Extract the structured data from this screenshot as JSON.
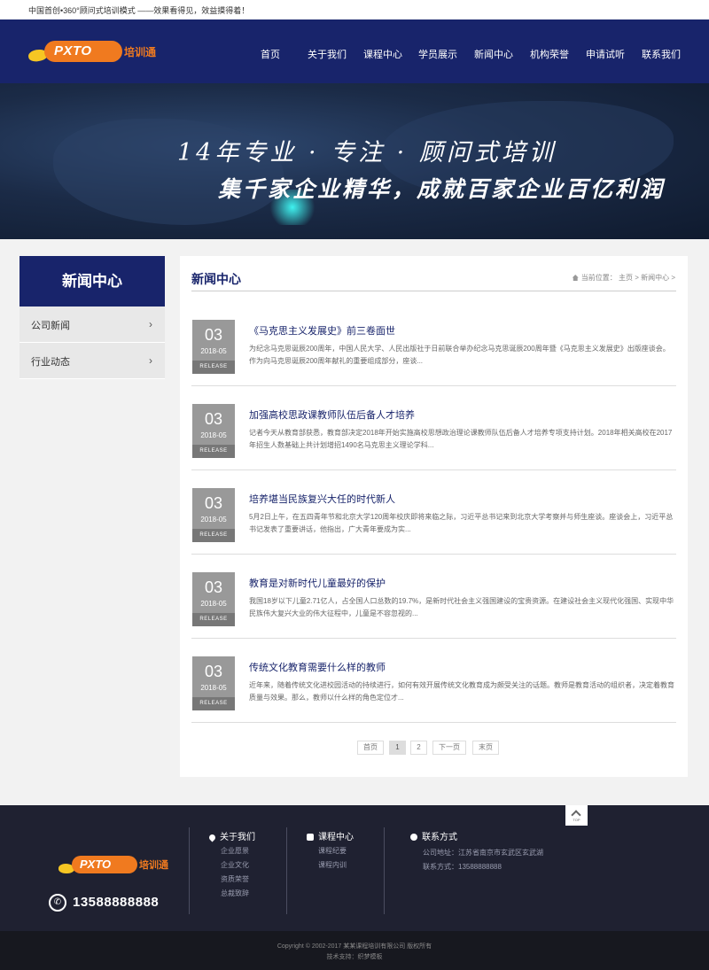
{
  "topbar": {
    "slogan": "中国首创•360°顾问式培训模式 ——效果看得见，效益摸得着！"
  },
  "logo": {
    "brand": "PXTO",
    "cn": "培训通"
  },
  "nav": [
    "首页",
    "关于我们",
    "课程中心",
    "学员展示",
    "新闻中心",
    "机构荣誉",
    "申请试听",
    "联系我们"
  ],
  "banner": {
    "line1": "14年专业 · 专注 · 顾问式培训",
    "line2": "集千家企业精华，成就百家企业百亿利润"
  },
  "sidebar": {
    "title": "新闻中心",
    "items": [
      "公司新闻",
      "行业动态"
    ],
    "chevron": "›"
  },
  "main": {
    "title": "新闻中心",
    "crumb_prefix": "当前位置：",
    "crumb_home": "主页",
    "crumb_sep": ">",
    "crumb_current": "新闻中心",
    "crumb_end": ">"
  },
  "news": [
    {
      "day": "03",
      "ym": "2018-05",
      "tag": "RELEASE",
      "title": "《马克思主义发展史》前三卷面世",
      "desc": "为纪念马克思诞辰200周年，中国人民大学、人民出版社于日前联合举办纪念马克思诞辰200周年暨《马克思主义发展史》出版座谈会。 作为向马克思诞辰200周年献礼的重要组成部分，座谈..."
    },
    {
      "day": "03",
      "ym": "2018-05",
      "tag": "RELEASE",
      "title": "加强高校思政课教师队伍后备人才培养",
      "desc": "记者今天从教育部获悉，教育部决定2018年开始实施高校思想政治理论课教师队伍后备人才培养专项支持计划。2018年相关高校在2017年招生人数基础上共计划增招1490名马克思主义理论学科..."
    },
    {
      "day": "03",
      "ym": "2018-05",
      "tag": "RELEASE",
      "title": "培养堪当民族复兴大任的时代新人",
      "desc": "5月2日上午，在五四青年节和北京大学120周年校庆即将来临之际，习近平总书记来到北京大学考察并与师生座谈。座谈会上，习近平总书记发表了重要讲话，他指出，广大青年要成为实..."
    },
    {
      "day": "03",
      "ym": "2018-05",
      "tag": "RELEASE",
      "title": "教育是对新时代儿童最好的保护",
      "desc": "我国18岁以下儿童2.71亿人，占全国人口总数的19.7%，是新时代社会主义强国建设的宝贵资源。在建设社会主义现代化强国、实现中华民族伟大复兴大业的伟大征程中，儿童是不容忽视的..."
    },
    {
      "day": "03",
      "ym": "2018-05",
      "tag": "RELEASE",
      "title": "传统文化教育需要什么样的教师",
      "desc": "近年来，随着传统文化进校园活动的持续进行，如何有效开展传统文化教育成为颇受关注的话题。教师是教育活动的组织者，决定着教育质量与效果。那么，教师以什么样的角色定位才..."
    }
  ],
  "pager": {
    "first": "首页",
    "p1": "1",
    "p2": "2",
    "next": "下一页",
    "last": "末页"
  },
  "totop": {
    "label": "TOP"
  },
  "footer": {
    "phone": "13588888888",
    "col1_title": "关于我们",
    "col1_links": [
      "企业愿景",
      "企业文化",
      "资质荣誉",
      "总裁致辞"
    ],
    "col2_title": "课程中心",
    "col2_links": [
      "课程纪要",
      "课程内训"
    ],
    "col3_title": "联系方式",
    "address": "公司地址：江苏省南京市玄武区玄武湖",
    "contact": "联系方式：13588888888",
    "copyright": "Copyright © 2002-2017 某某课程培训有限公司 版权所有",
    "support": "技术支持：织梦模板"
  },
  "colors": {
    "navy": "#18246b",
    "orange": "#f07a1f",
    "footer": "#1f2131"
  }
}
